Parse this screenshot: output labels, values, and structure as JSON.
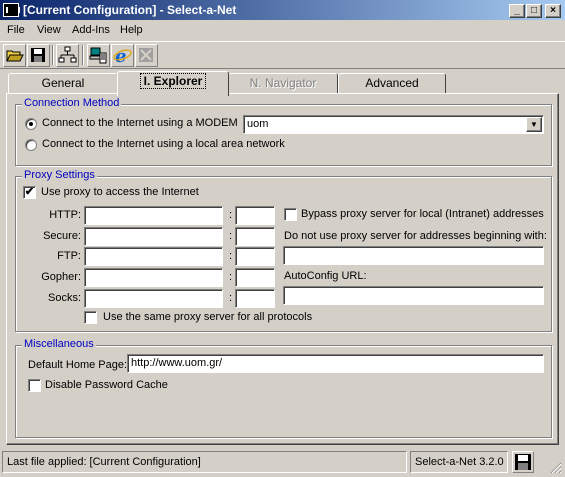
{
  "window": {
    "title": "[Current Configuration] - Select-a-Net",
    "controls": {
      "minimize": "_",
      "maximize": "□",
      "close": "×"
    }
  },
  "menu": [
    "File",
    "View",
    "Add-Ins",
    "Help"
  ],
  "toolbar": {
    "buttons": [
      "open-folder-icon",
      "save-disk-icon",
      "network-icon",
      "computer-settings-icon",
      "internet-explorer-icon",
      "netscape-navigator-icon"
    ]
  },
  "tabs": [
    {
      "label": "General",
      "state": "normal"
    },
    {
      "label": "I. Explorer",
      "state": "selected"
    },
    {
      "label": "N. Navigator",
      "state": "disabled"
    },
    {
      "label": "Advanced",
      "state": "normal"
    }
  ],
  "connection": {
    "legend": "Connection Method",
    "modem_label": "Connect to the Internet using a MODEM",
    "modem_selected": true,
    "modem_value": "uom",
    "lan_label": "Connect to the Internet using a local area network",
    "lan_selected": false
  },
  "proxy": {
    "legend": "Proxy Settings",
    "use_proxy_label": "Use proxy to access the Internet",
    "use_proxy_checked": "✔",
    "protocols": [
      {
        "label": "HTTP:",
        "address": "",
        "port": ""
      },
      {
        "label": "Secure:",
        "address": "",
        "port": ""
      },
      {
        "label": "FTP:",
        "address": "",
        "port": ""
      },
      {
        "label": "Gopher:",
        "address": "",
        "port": ""
      },
      {
        "label": "Socks:",
        "address": "",
        "port": ""
      }
    ],
    "colon": ":",
    "bypass_label": "Bypass proxy server for local (Intranet) addresses",
    "bypass_checked": false,
    "exceptions_label": "Do not use proxy server for addresses beginning with:",
    "exceptions_value": "",
    "autoconfig_label": "AutoConfig URL:",
    "autoconfig_value": "",
    "same_proxy_label": "Use the same proxy server for all protocols",
    "same_proxy_checked": false
  },
  "misc": {
    "legend": "Miscellaneous",
    "home_page_label": "Default Home Page:",
    "home_page_value": "http://www.uom.gr/",
    "disable_cache_label": "Disable Password Cache",
    "disable_cache_checked": false
  },
  "status": {
    "last_file": "Last file applied: [Current Configuration]",
    "version": "Select-a-Net 3.2.0",
    "save_icon": "save-disk-icon"
  },
  "colors": {
    "title_start": "#0a246a",
    "title_end": "#a6caf0",
    "legend_text": "#0000c0",
    "face": "#d4d0c8"
  }
}
